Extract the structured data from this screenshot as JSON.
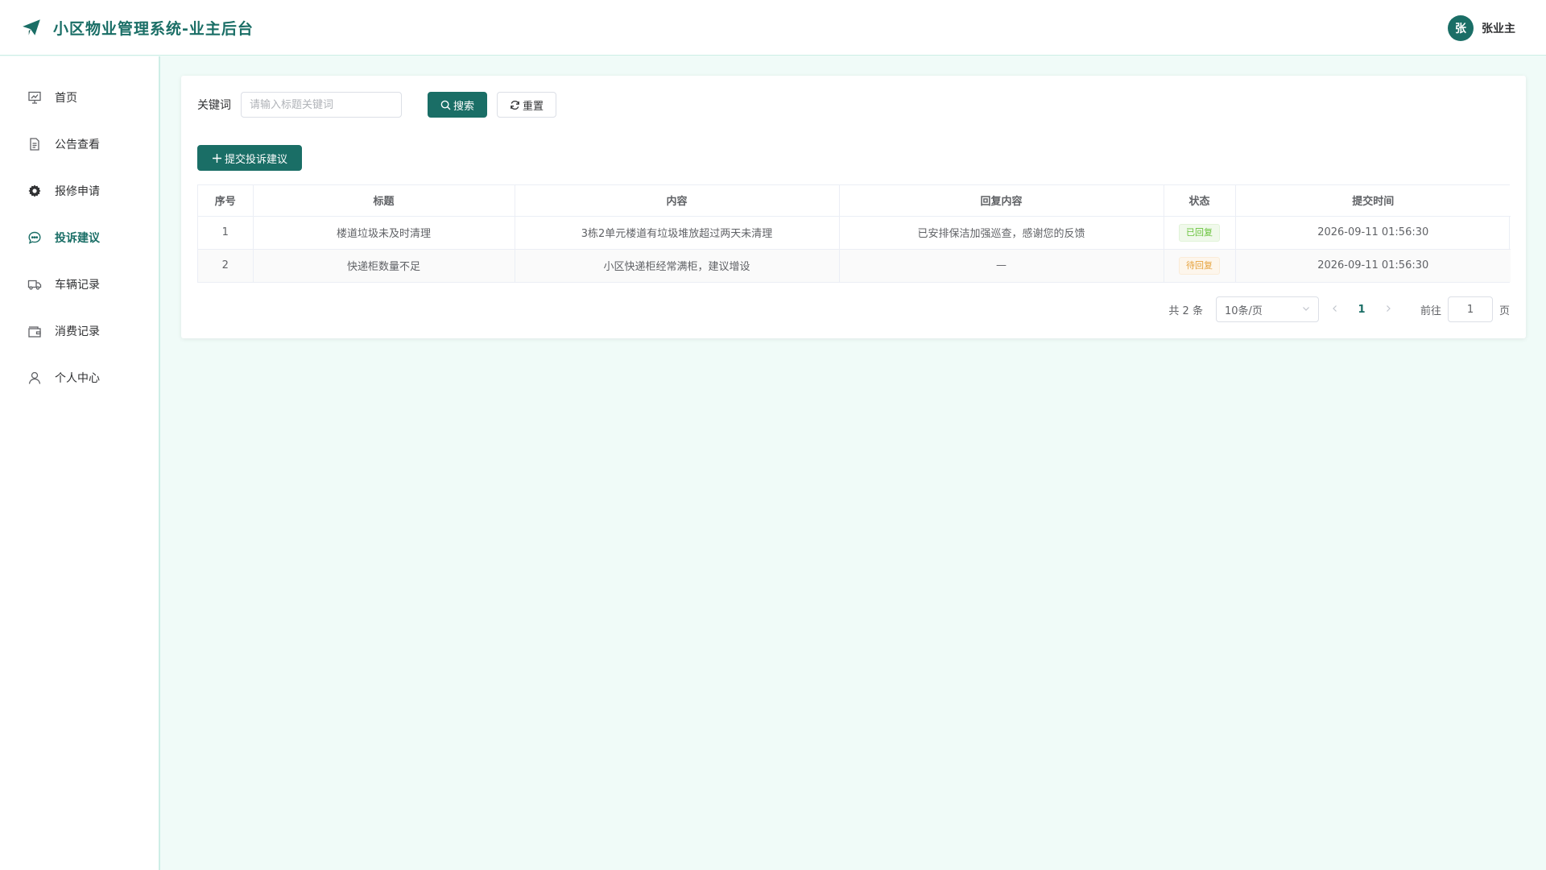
{
  "header": {
    "title": "小区物业管理系统-业主后台",
    "avatar_text": "张",
    "user_name": "张业主"
  },
  "sidebar": {
    "items": [
      {
        "label": "首页",
        "icon": "dashboard-icon"
      },
      {
        "label": "公告查看",
        "icon": "document-icon"
      },
      {
        "label": "报修申请",
        "icon": "gear-icon"
      },
      {
        "label": "投诉建议",
        "icon": "chat-bubble-icon",
        "active": true
      },
      {
        "label": "车辆记录",
        "icon": "truck-icon"
      },
      {
        "label": "消费记录",
        "icon": "wallet-icon"
      },
      {
        "label": "个人中心",
        "icon": "user-icon"
      }
    ]
  },
  "search": {
    "label": "关键词",
    "placeholder": "请输入标题关键词",
    "search_label": "搜索",
    "reset_label": "重置"
  },
  "add_button_label": "提交投诉建议",
  "table": {
    "columns": [
      "序号",
      "标题",
      "内容",
      "回复内容",
      "状态",
      "提交时间"
    ],
    "rows": [
      {
        "index": "1",
        "title": "楼道垃圾未及时清理",
        "content": "3栋2单元楼道有垃圾堆放超过两天未清理",
        "reply": "已安排保洁加强巡查，感谢您的反馈",
        "status": "已回复",
        "status_type": "success",
        "time": "2026-09-11 01:56:30"
      },
      {
        "index": "2",
        "title": "快递柜数量不足",
        "content": "小区快递柜经常满柜，建议增设",
        "reply": "—",
        "status": "待回复",
        "status_type": "warning",
        "time": "2026-09-11 01:56:30"
      }
    ]
  },
  "pagination": {
    "total_text": "共 2 条",
    "page_size": "10条/页",
    "current_page": "1",
    "goto_label": "前往",
    "goto_value": "1",
    "page_unit": "页"
  },
  "colors": {
    "primary": "#1a6e66",
    "background": "#f0fbf8",
    "success": "#67c23a",
    "warning": "#e6a23c"
  }
}
